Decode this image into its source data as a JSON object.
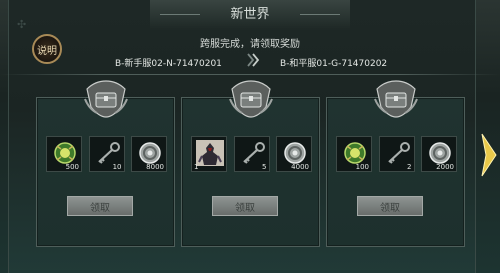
{
  "title": "新世界",
  "help_label": "说明",
  "subtitle": "跨服完成，请领取奖励",
  "servers": {
    "from": "B-新手服02-N-71470201",
    "to": "B-和平服01-G-71470202"
  },
  "cards": [
    {
      "items": [
        {
          "icon": "green-orb-icon",
          "qty": "500"
        },
        {
          "icon": "key-icon",
          "qty": "10"
        },
        {
          "icon": "silver-coin-icon",
          "qty": "8000"
        }
      ],
      "claim_label": "领取"
    },
    {
      "items": [
        {
          "icon": "armored-warrior-icon",
          "qty": "1"
        },
        {
          "icon": "key-icon",
          "qty": "5"
        },
        {
          "icon": "silver-coin-icon",
          "qty": "4000"
        }
      ],
      "claim_label": "领取"
    },
    {
      "items": [
        {
          "icon": "green-orb-icon",
          "qty": "100"
        },
        {
          "icon": "key-icon",
          "qty": "2"
        },
        {
          "icon": "silver-coin-icon",
          "qty": "2000"
        }
      ],
      "claim_label": "领取"
    }
  ],
  "colors": {
    "accent_gold": "#a88a57",
    "panel_border": "#4e5e5a",
    "next_arrow": "#e9c94a"
  }
}
